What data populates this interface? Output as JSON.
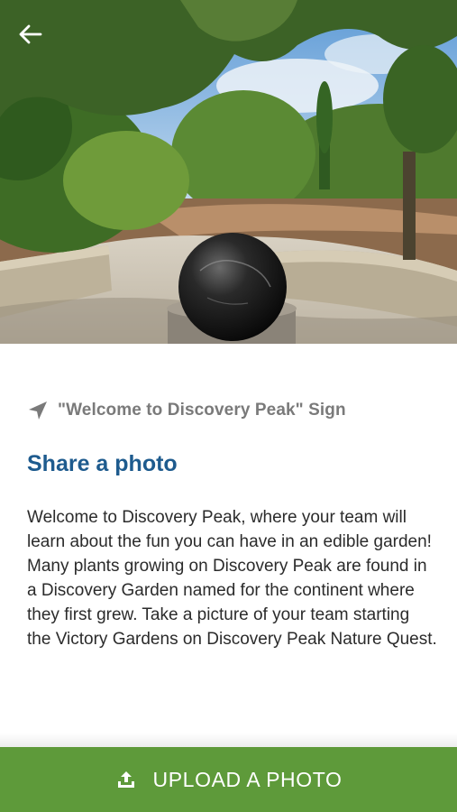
{
  "header": {
    "back_icon": "arrow-left-icon",
    "hero_image": "fountain-garden-photo"
  },
  "location": {
    "icon": "navigation-arrow-icon",
    "label": "\"Welcome to Discovery Peak\" Sign"
  },
  "task": {
    "title": "Share a photo",
    "description": "Welcome to Discovery Peak, where your team will learn about the fun you can have in an edible garden! Many plants growing on Discovery Peak are found in a Discovery Garden named for the continent where they first grew. Take a picture of your team starting the Victory Gardens on Discovery Peak Nature Quest."
  },
  "action": {
    "icon": "upload-icon",
    "label": "UPLOAD A PHOTO"
  },
  "colors": {
    "title": "#1e5b8e",
    "button": "#5e9a3a",
    "muted_text": "#7a7a7a"
  }
}
